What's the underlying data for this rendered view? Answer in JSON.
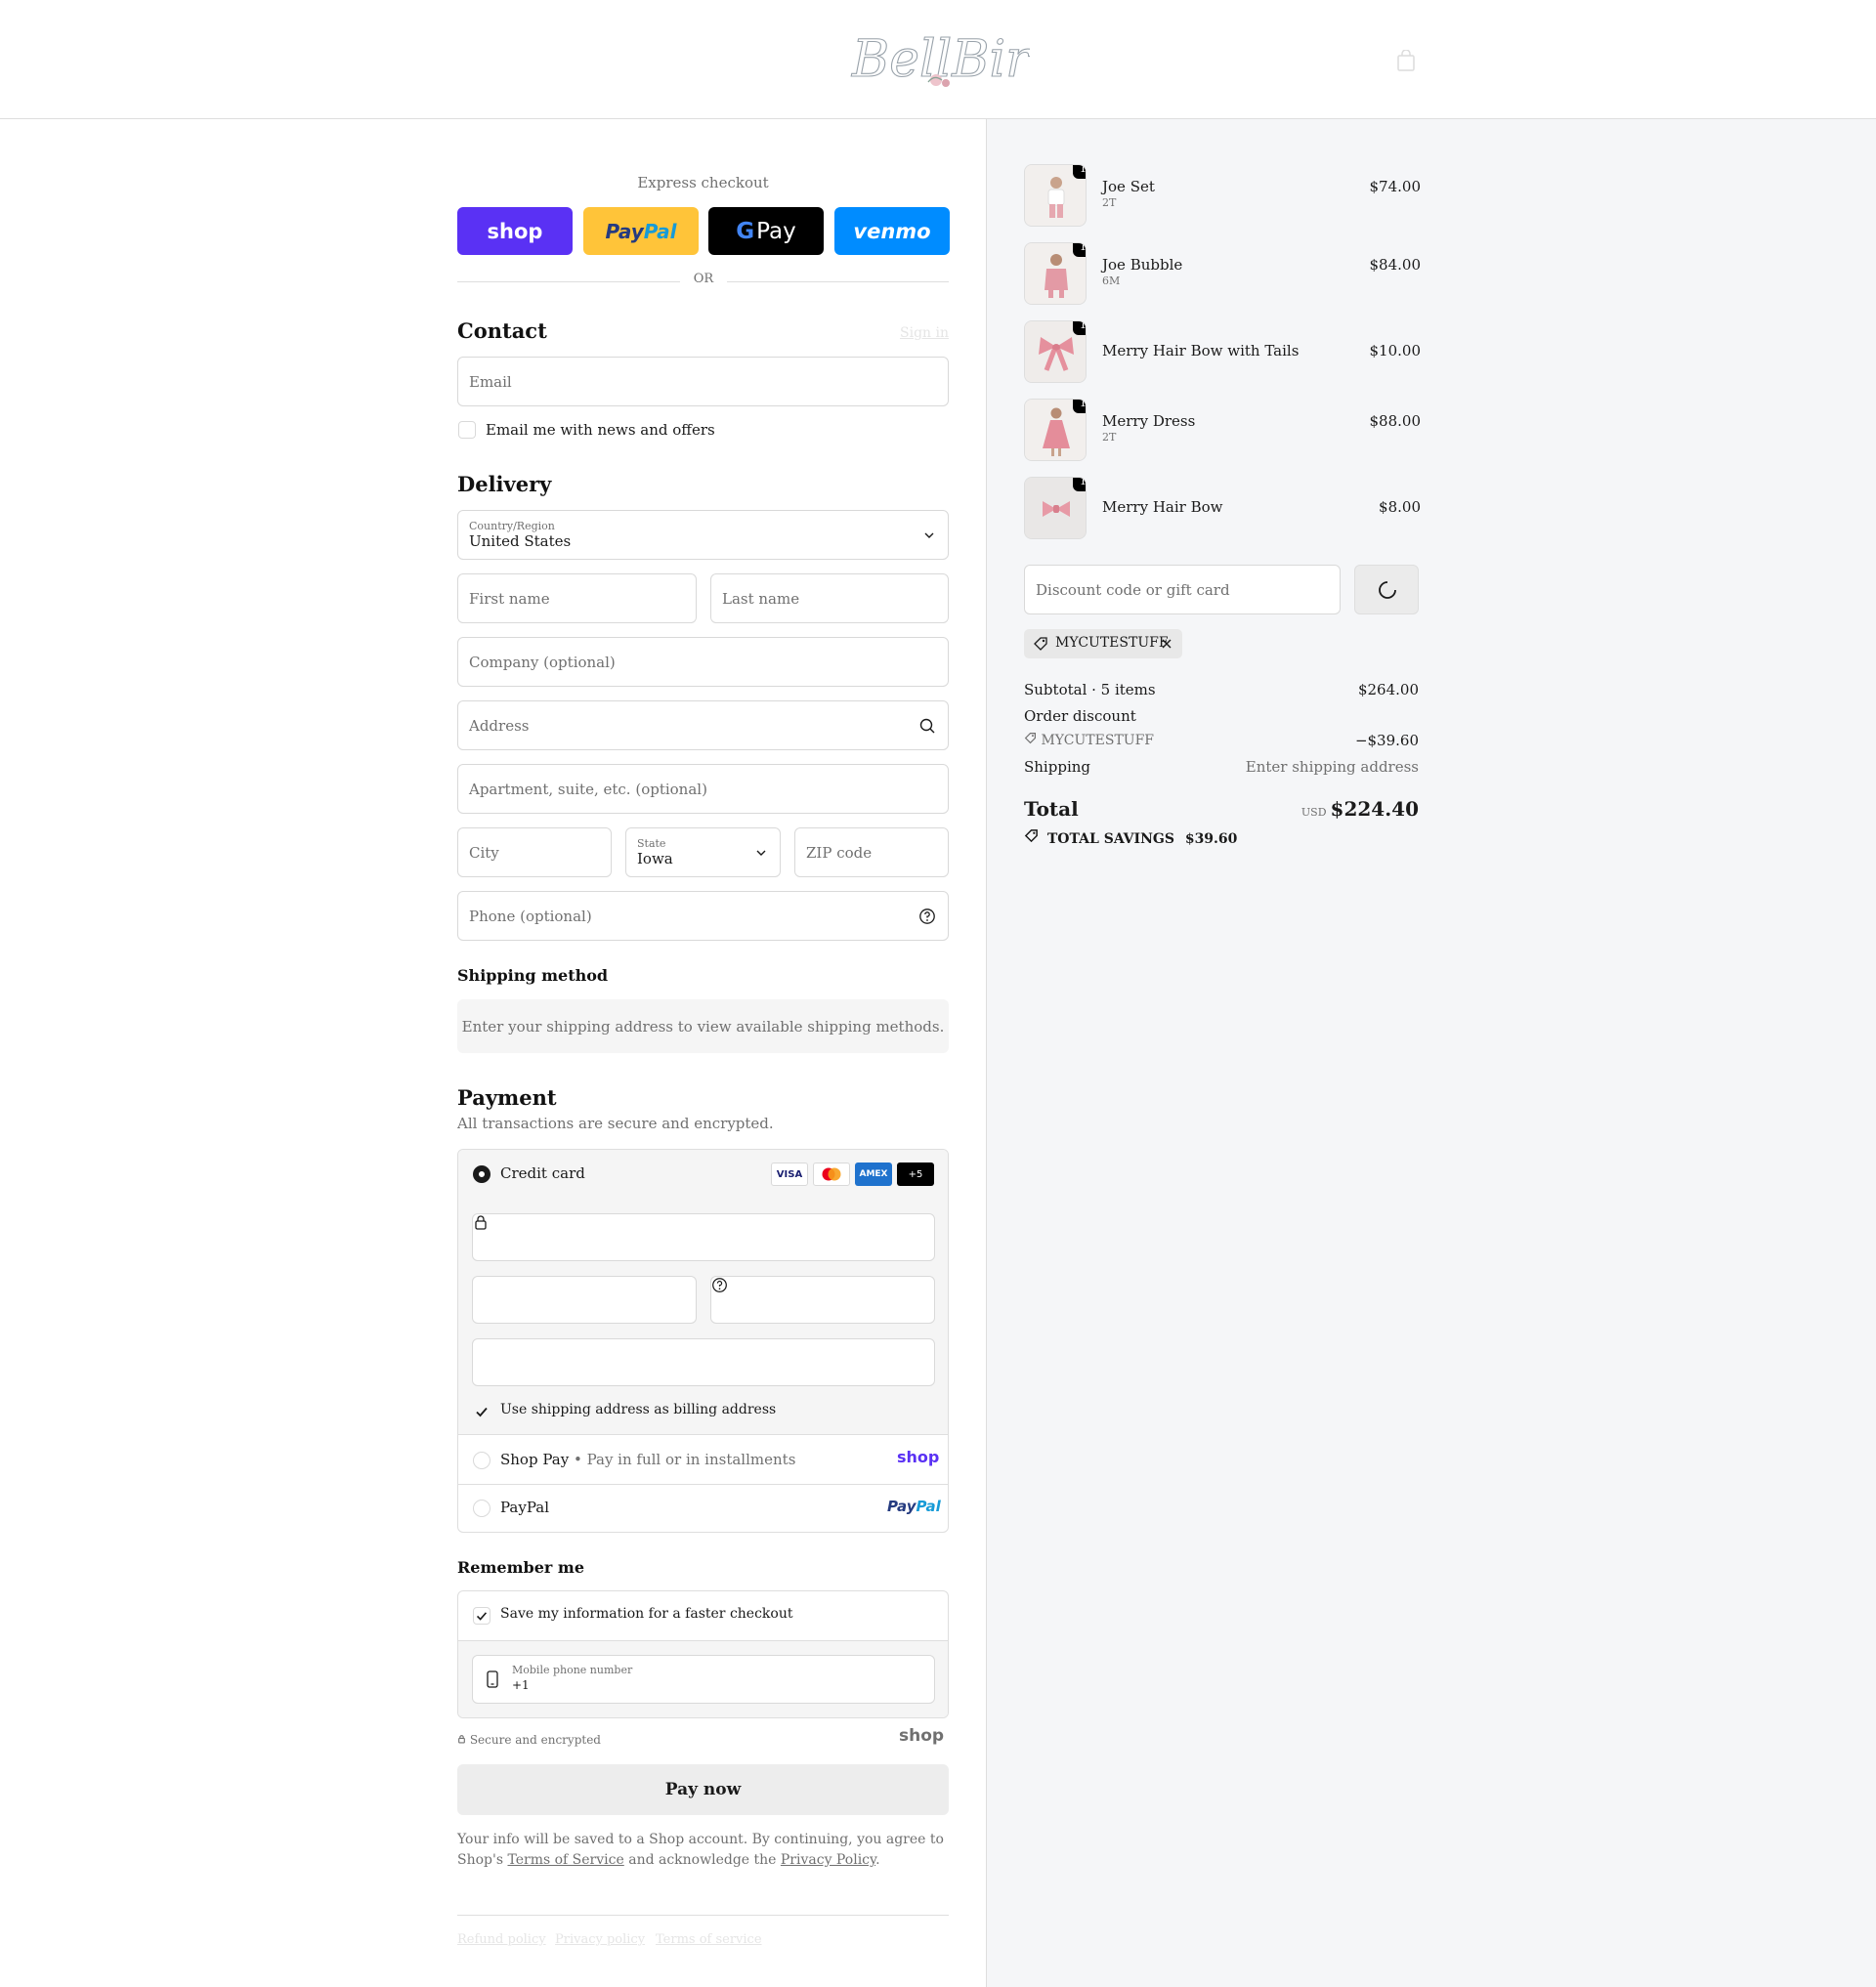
{
  "header": {
    "logo_text": "BellBird",
    "cart_icon": "shopping-bag-icon"
  },
  "express": {
    "title": "Express checkout",
    "shop_label": "shop",
    "paypal_label_a": "Pay",
    "paypal_label_b": "Pal",
    "gpay_g": "G",
    "gpay_label": "Pay",
    "venmo_label": "venmo",
    "or_text": "OR"
  },
  "contact": {
    "heading": "Contact",
    "sign_in": "Sign in",
    "email_placeholder": "Email",
    "newsletter_label": "Email me with news and offers"
  },
  "delivery": {
    "heading": "Delivery",
    "country_label": "Country/Region",
    "country_value": "United States",
    "first_name": "First name",
    "last_name": "Last name",
    "company": "Company (optional)",
    "address": "Address",
    "apartment": "Apartment, suite, etc. (optional)",
    "city": "City",
    "state_label": "State",
    "state_value": "Iowa",
    "zip": "ZIP code",
    "phone": "Phone (optional)"
  },
  "shipping_method": {
    "heading": "Shipping method",
    "note": "Enter your shipping address to view available shipping methods."
  },
  "payment": {
    "heading": "Payment",
    "subtitle": "All transactions are secure and encrypted.",
    "credit_card_label": "Credit card",
    "card_logos": [
      "VISA",
      "",
      "AMEX",
      "+5"
    ],
    "billing_label": "Use shipping address as billing address",
    "shop_pay_label": "Shop Pay",
    "shop_pay_sub": "Pay in full or in installments",
    "shop_brand": "shop",
    "paypal_label": "PayPal",
    "paypal_brand_a": "Pay",
    "paypal_brand_b": "Pal"
  },
  "remember": {
    "heading": "Remember me",
    "save_label": "Save my information for a faster checkout",
    "phone_label": "Mobile phone number",
    "phone_prefix": "+1"
  },
  "footer_area": {
    "secure_text": "Secure and encrypted",
    "shop_brand": "shop",
    "pay_now": "Pay now",
    "agree_a": "Your info will be saved to a Shop account. By continuing, you agree to Shop's ",
    "terms_link": "Terms of Service",
    "agree_b": " and acknowledge the ",
    "privacy_link": "Privacy Policy",
    "agree_c": ".",
    "links": [
      "Refund policy",
      "Privacy policy",
      "Terms of service"
    ]
  },
  "cart": {
    "items": [
      {
        "name": "Joe Set",
        "variant": "2T",
        "price": "$74.00",
        "qty": "1"
      },
      {
        "name": "Joe Bubble",
        "variant": "6M",
        "price": "$84.00",
        "qty": "1"
      },
      {
        "name": "Merry Hair Bow with Tails",
        "variant": "",
        "price": "$10.00",
        "qty": "1"
      },
      {
        "name": "Merry Dress",
        "variant": "2T",
        "price": "$88.00",
        "qty": "1"
      },
      {
        "name": "Merry Hair Bow",
        "variant": "",
        "price": "$8.00",
        "qty": "1"
      }
    ],
    "discount_placeholder": "Discount code or gift card",
    "applied_code": "MYCUTESTUFF",
    "subtotal_label": "Subtotal · 5 items",
    "subtotal_value": "$264.00",
    "order_discount_label": "Order discount",
    "discount_code": "MYCUTESTUFF",
    "discount_value": "−$39.60",
    "shipping_label": "Shipping",
    "shipping_value": "Enter shipping address",
    "total_label": "Total",
    "currency": "USD",
    "total_value": "$224.40",
    "savings_label": "TOTAL SAVINGS",
    "savings_value": "$39.60"
  },
  "colors": {
    "shop": "#5a31f4",
    "paypal": "#ffc439",
    "venmo": "#008cff",
    "panel": "#f5f6f8"
  }
}
